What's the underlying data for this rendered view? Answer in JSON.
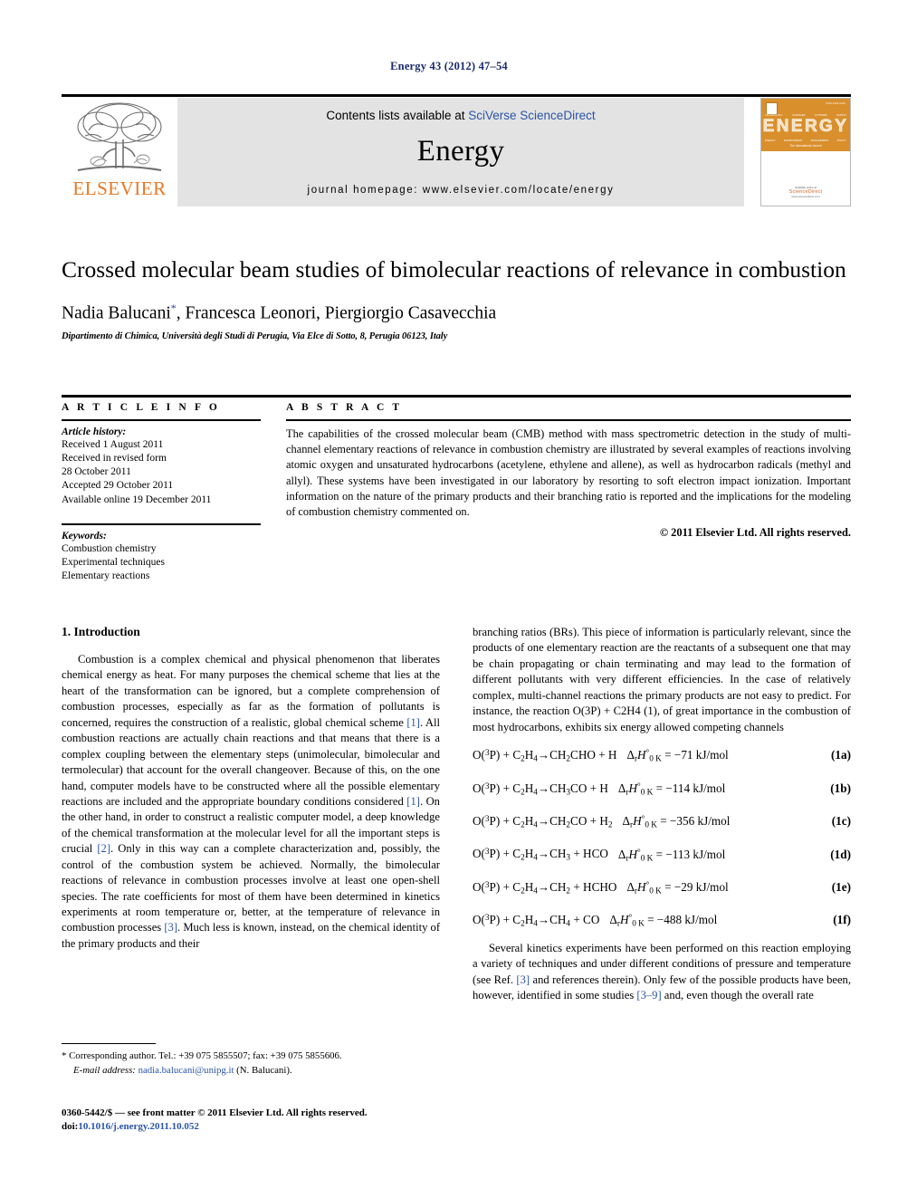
{
  "running_head": "Energy 43 (2012) 47–54",
  "masthead": {
    "publisher_wordmark": "ELSEVIER",
    "contents_prefix": "Contents lists available at ",
    "contents_link": "SciVerse ScienceDirect",
    "journal_title": "Energy",
    "homepage": "journal homepage: www.elsevier.com/locate/energy",
    "cover": {
      "title": "ENERGY",
      "subtitle": "The International Journal",
      "keywords_top": [
        "TECHNOLOGY",
        "SCIENCES",
        "SYSTEMS",
        "SUPPLY"
      ],
      "keywords_bottom": [
        "ENERGY",
        "ENVIRONMENT",
        "MANAGEMENT",
        "POLICY"
      ],
      "issn_code": "ISSN 0360-5442",
      "footer_small": "Available online at",
      "footer_brand": "ScienceDirect",
      "footer_url": "www.sciencedirect.com"
    }
  },
  "article": {
    "title": "Crossed molecular beam studies of bimolecular reactions of relevance in combustion",
    "authors": "Nadia Balucani",
    "authors_rest": ", Francesca Leonori, Piergiorgio Casavecchia",
    "corresponding_marker": "*",
    "affiliation": "Dipartimento di Chimica, Università degli Studi di Perugia, Via Elce di Sotto, 8, Perugia 06123, Italy"
  },
  "info": {
    "heading": "A R T I C L E  I N F O",
    "history_label": "Article history:",
    "history": [
      "Received 1 August 2011",
      "Received in revised form",
      "28 October 2011",
      "Accepted 29 October 2011",
      "Available online 19 December 2011"
    ],
    "keywords_label": "Keywords:",
    "keywords": [
      "Combustion chemistry",
      "Experimental techniques",
      "Elementary reactions"
    ]
  },
  "abstract": {
    "heading": "A B S T R A C T",
    "text": "The capabilities of the crossed molecular beam (CMB) method with mass spectrometric detection in the study of multi-channel elementary reactions of relevance in combustion chemistry are illustrated by several examples of reactions involving atomic oxygen and unsaturated hydrocarbons (acetylene, ethylene and allene), as well as hydrocarbon radicals (methyl and allyl). These systems have been investigated in our laboratory by resorting to soft electron impact ionization. Important information on the nature of the primary products and their branching ratio is reported and the implications for the modeling of combustion chemistry commented on.",
    "copyright": "© 2011 Elsevier Ltd. All rights reserved."
  },
  "body": {
    "section_title": "1. Introduction",
    "left_para_1_a": "Combustion is a complex chemical and physical phenomenon that liberates chemical energy as heat. For many purposes the chemical scheme that lies at the heart of the transformation can be ignored, but a complete comprehension of combustion processes, especially as far as the formation of pollutants is concerned, requires the construction of a realistic, global chemical scheme ",
    "left_cite_1": "[1]",
    "left_para_1_b": ". All combustion reactions are actually chain reactions and that means that there is a complex coupling between the elementary steps (unimolecular, bimolecular and termolecular) that account for the overall changeover. Because of this, on the one hand, computer models have to be constructed where all the possible elementary reactions are included and the appropriate boundary conditions considered ",
    "left_cite_2": "[1]",
    "left_para_1_c": ". On the other hand, in order to construct a realistic computer model, a deep knowledge of the chemical transformation at the molecular level for all the important steps is crucial ",
    "left_cite_3": "[2]",
    "left_para_1_d": ". Only in this way can a complete characterization and, possibly, the control of the combustion system be achieved. Normally, the bimolecular reactions of relevance in combustion processes involve at least one open-shell species. The rate coefficients for most of them have been determined in kinetics experiments at room temperature or, better, at the temperature of relevance in combustion processes ",
    "left_cite_4": "[3]",
    "left_para_1_e": ". Much less is known, instead, on the chemical identity of the primary products and their",
    "right_para_1": "branching ratios (BRs). This piece of information is particularly relevant, since the products of one elementary reaction are the reactants of a subsequent one that may be chain propagating or chain terminating and may lead to the formation of different pollutants with very different efficiencies. In the case of relatively complex, multi-channel reactions the primary products are not easy to predict. For instance, the reaction O(3P) + C2H4 (1), of great importance in the combustion of most hydrocarbons, exhibits six energy allowed competing channels",
    "right_para_2_a": "Several kinetics experiments have been performed on this reaction employing a variety of techniques and under different conditions of pressure and temperature (see Ref. ",
    "right_cite_1": "[3]",
    "right_para_2_b": " and references therein). Only few of the possible products have been, however, identified in some studies ",
    "right_cite_2": "[3–9]",
    "right_para_2_c": " and, even though the overall rate"
  },
  "equations": [
    {
      "products": "CH2CHO + H",
      "enthalpy": "= −71 kJ/mol",
      "number": "(1a)"
    },
    {
      "products": "CH3CO + H",
      "enthalpy": "= −114 kJ/mol",
      "number": "(1b)"
    },
    {
      "products": "CH2CO + H2",
      "enthalpy": "= −356 kJ/mol",
      "number": "(1c)"
    },
    {
      "products": "CH3 + HCO",
      "enthalpy": "= −113 kJ/mol",
      "number": "(1d)"
    },
    {
      "products": "CH2 + HCHO",
      "enthalpy": "= −29 kJ/mol",
      "number": "(1e)"
    },
    {
      "products": "CH4 + CO",
      "enthalpy": "= −488 kJ/mol",
      "number": "(1f)"
    }
  ],
  "equation_common": {
    "reactant_o": "O",
    "reactant_o_sup": "3",
    "reactant_o_tail": "P",
    "reactant_c2h4": "C2H4",
    "arrow": "→",
    "delta_symbol": "Δ",
    "delta_sub": "r",
    "h_symbol": "H",
    "h_sup": "°",
    "h_sub": "0 K"
  },
  "footnote": {
    "corresponding": "* Corresponding author. Tel.: +39 075 5855507; fax: +39 075 5855606.",
    "email_label": "E-mail address:",
    "email": "nadia.balucani@unipg.it",
    "email_suffix": " (N. Balucani)."
  },
  "imprint": {
    "line1": "0360-5442/$ — see front matter © 2011 Elsevier Ltd. All rights reserved.",
    "doi_label": "doi:",
    "doi": "10.1016/j.energy.2011.10.052"
  },
  "colors": {
    "link": "#2b54a8",
    "running_head": "#1b2a6b",
    "elsevier_orange": "#E87722",
    "cover_orange": "#d98f2c",
    "masthead_bg": "#e3e3e3"
  }
}
